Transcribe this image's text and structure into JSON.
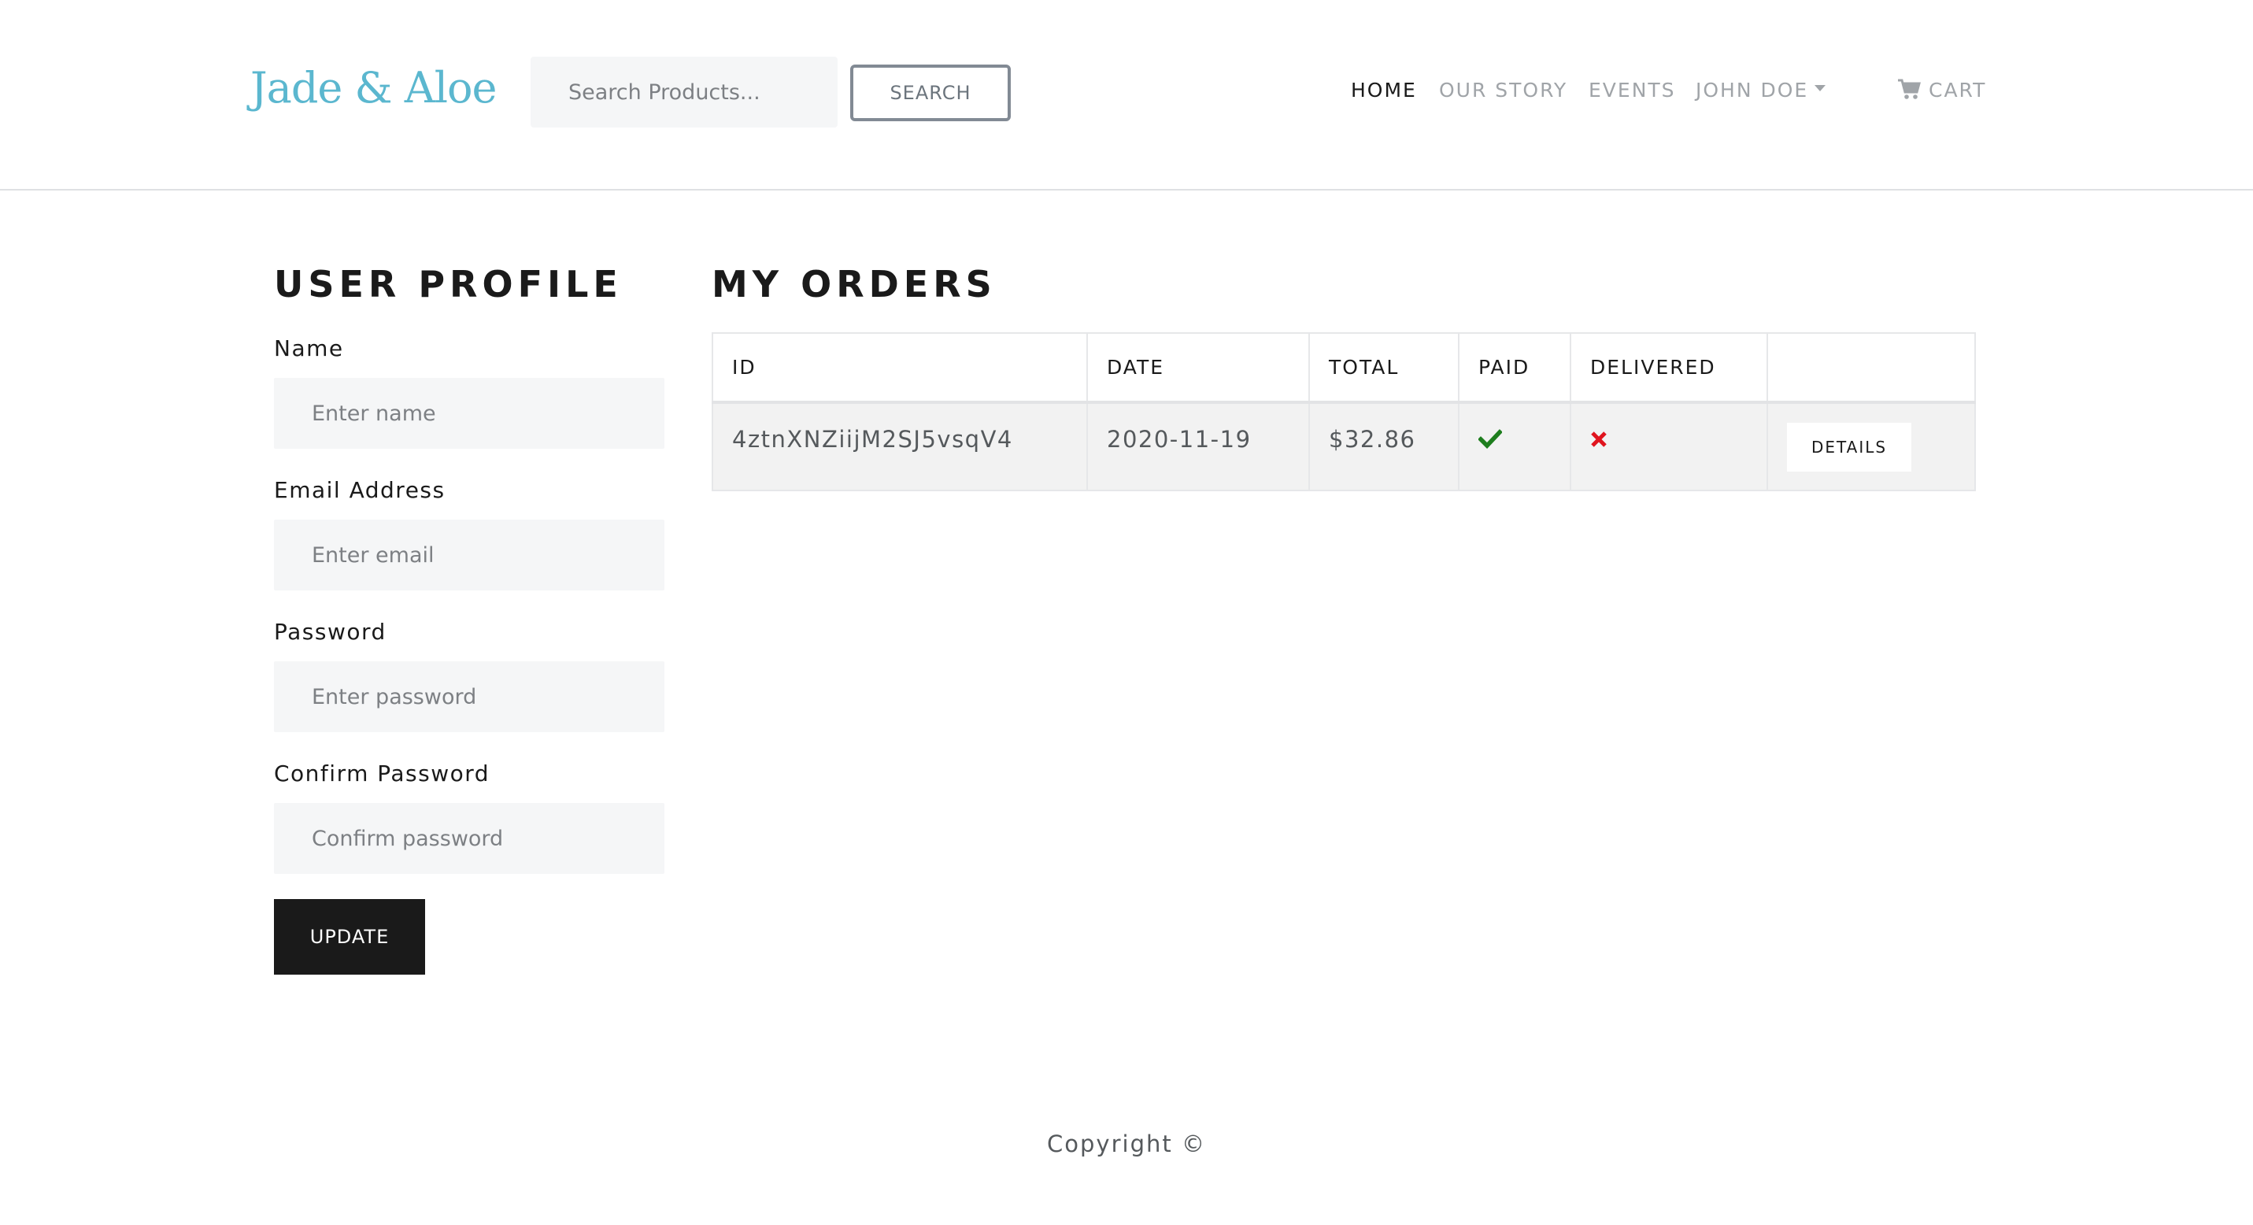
{
  "brand": "Jade & Aloe",
  "search": {
    "placeholder": "Search Products...",
    "button_label": "SEARCH"
  },
  "nav": {
    "home": "HOME",
    "our_story": "OUR STORY",
    "events": "EVENTS",
    "user": "JOHN DOE",
    "cart": "CART"
  },
  "profile": {
    "title": "USER PROFILE",
    "fields": [
      {
        "label": "Name",
        "placeholder": "Enter name"
      },
      {
        "label": "Email Address",
        "placeholder": "Enter email"
      },
      {
        "label": "Password",
        "placeholder": "Enter password"
      },
      {
        "label": "Confirm Password",
        "placeholder": "Confirm password"
      }
    ],
    "update_label": "UPDATE"
  },
  "orders": {
    "title": "MY ORDERS",
    "columns": [
      "ID",
      "DATE",
      "TOTAL",
      "PAID",
      "DELIVERED",
      ""
    ],
    "rows": [
      {
        "id": "4ztnXNZiijM2SJ5vsqV4",
        "date": "2020-11-19",
        "total": "$32.86",
        "paid": true,
        "delivered": false,
        "details_label": "DETAILS"
      }
    ]
  },
  "footer": "Copyright ©",
  "colors": {
    "brand": "#5bb7cf",
    "paid_check": "#1e7e1e",
    "not_delivered_x": "#e0141e",
    "dark_button": "#1a1a1a"
  }
}
